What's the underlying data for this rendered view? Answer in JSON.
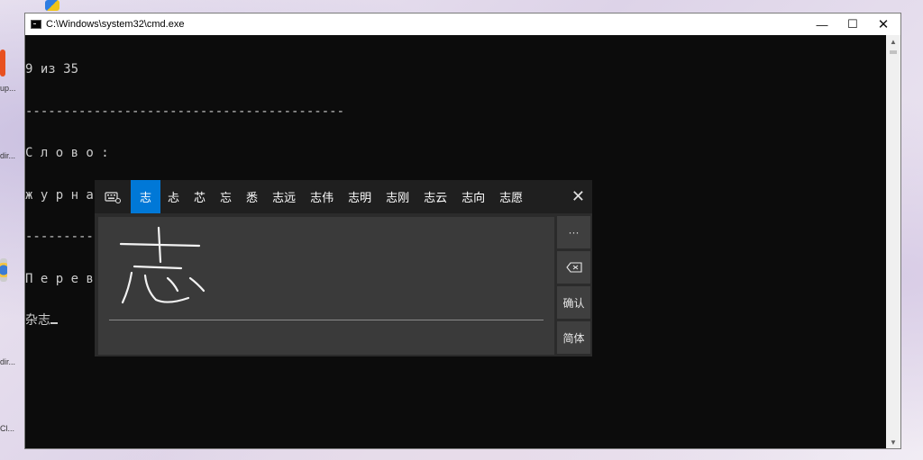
{
  "window": {
    "title": "C:\\Windows\\system32\\cmd.exe",
    "buttons": {
      "minimize": "—",
      "maximize": "☐",
      "close": "✕"
    }
  },
  "console": {
    "lines": [
      "9 из 35",
      "------------------------------------------",
      "С л о в о :",
      "ж у р н а л  (zázhì)",
      "------------------------------------------",
      "П е р е в о д  汉字:",
      "杂志"
    ]
  },
  "ime": {
    "candidates": [
      "志",
      "忐",
      "芯",
      "忘",
      "悉",
      "志远",
      "志伟",
      "志明",
      "志刚",
      "志云",
      "志向",
      "志愿"
    ],
    "selected_index": 0,
    "more_label": "···",
    "backspace_icon": "backspace-icon",
    "confirm_label": "确认",
    "mode_label": "简体",
    "close_label": "✕"
  },
  "desktop": {
    "labels": [
      "up...",
      "dir...",
      "dir...",
      "Cl..."
    ]
  },
  "colors": {
    "console_bg": "#0c0c0c",
    "console_fg": "#cccccc",
    "selected_candidate": "#0078d7",
    "ime_bg": "#2b2b2b"
  }
}
